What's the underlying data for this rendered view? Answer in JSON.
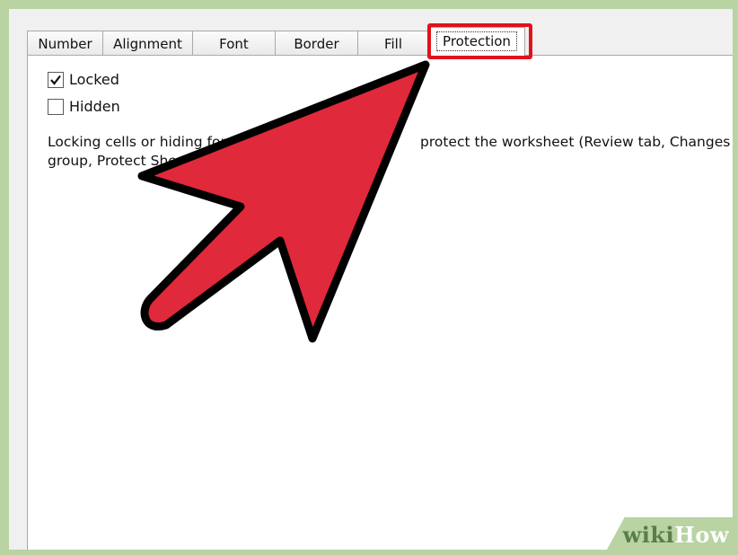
{
  "tabs": [
    {
      "label": "Number",
      "active": false
    },
    {
      "label": "Alignment",
      "active": false
    },
    {
      "label": "Font",
      "active": false
    },
    {
      "label": "Border",
      "active": false
    },
    {
      "label": "Fill",
      "active": false
    },
    {
      "label": "Protection",
      "active": true
    }
  ],
  "options": {
    "locked": {
      "label": "Locked",
      "checked": true
    },
    "hidden": {
      "label": "Hidden",
      "checked": false
    }
  },
  "help_text": {
    "line1_left": "Locking cells or hiding form",
    "line1_right": "protect the worksheet (Review tab, Changes",
    "line2": "group, Protect Shee"
  },
  "watermark": {
    "wiki": "wiki",
    "how": "How"
  },
  "colors": {
    "accent_red": "#e0121b",
    "arrow_fill": "#e0293a",
    "frame_green": "#b9d3a3"
  },
  "icons": {
    "pointer": "arrow-pointer-icon",
    "check": "check-icon"
  }
}
